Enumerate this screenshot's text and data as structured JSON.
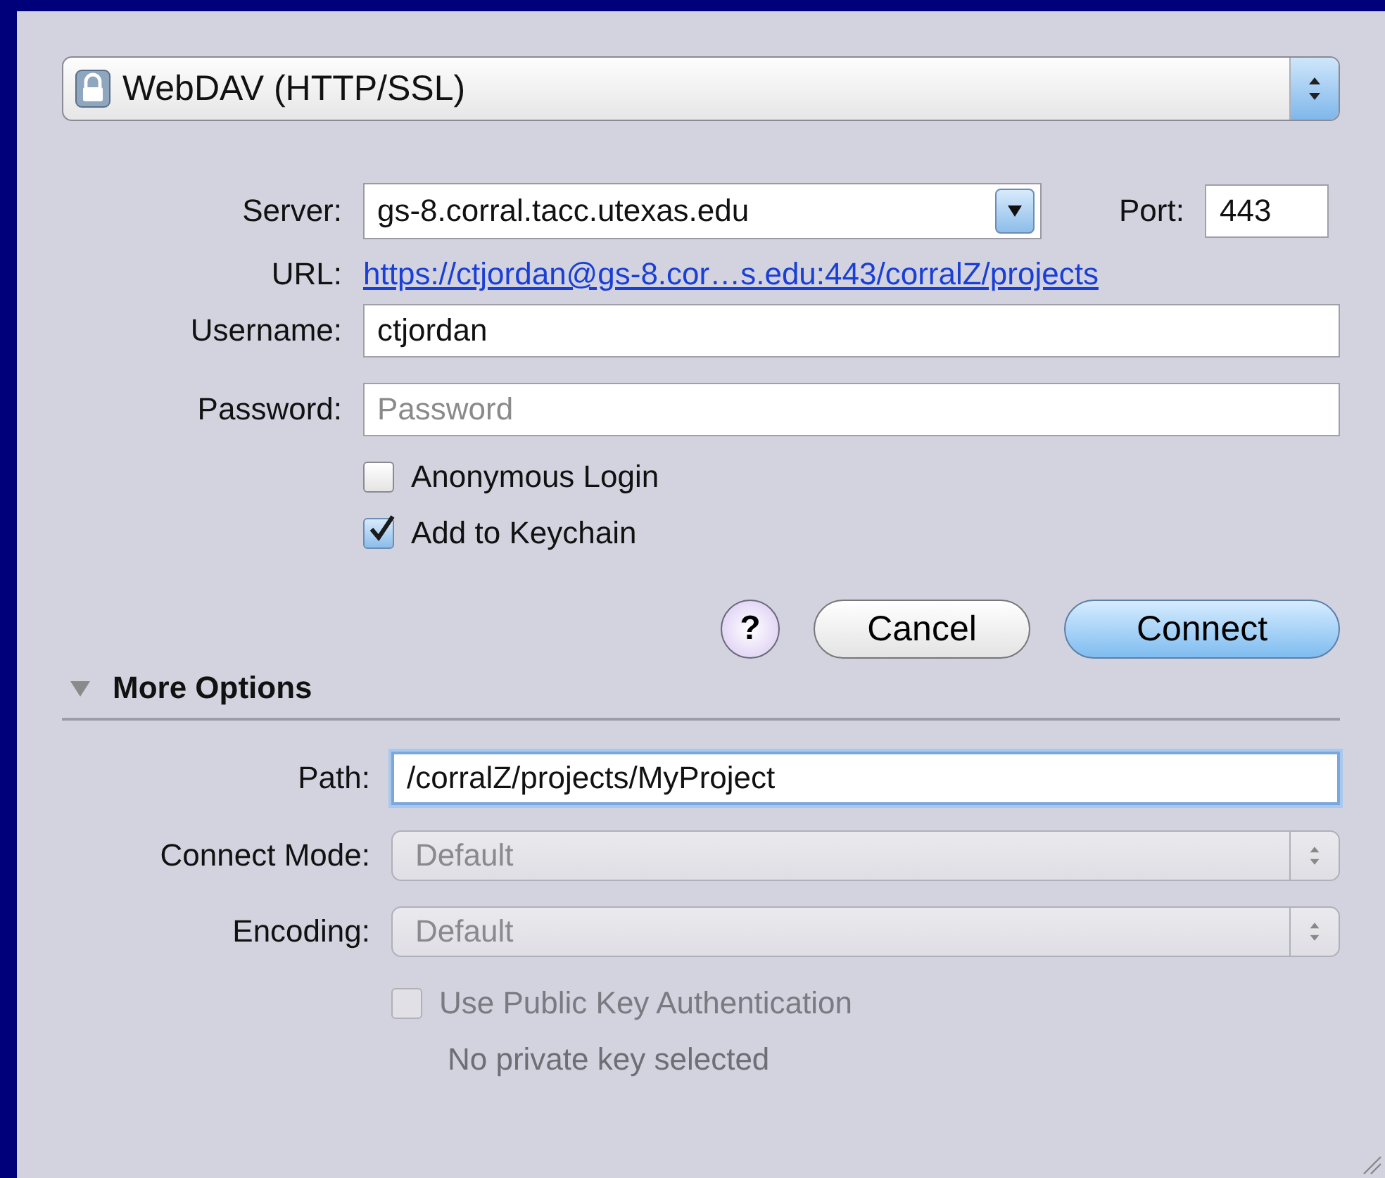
{
  "protocol": {
    "label": "WebDAV (HTTP/SSL)"
  },
  "server": {
    "label": "Server:",
    "value": "gs-8.corral.tacc.utexas.edu"
  },
  "port": {
    "label": "Port:",
    "value": "443"
  },
  "url": {
    "label": "URL:",
    "link": "https://ctjordan@gs-8.cor…s.edu:443/corralZ/projects"
  },
  "username": {
    "label": "Username:",
    "value": "ctjordan"
  },
  "password": {
    "label": "Password:",
    "placeholder": "Password"
  },
  "options": [
    {
      "label": "Anonymous Login",
      "checked": false
    },
    {
      "label": "Add to Keychain",
      "checked": true
    }
  ],
  "buttons": [
    {
      "kind": "help",
      "label": "?"
    },
    {
      "kind": "cancel",
      "label": "Cancel"
    },
    {
      "kind": "default",
      "label": "Connect"
    }
  ],
  "more_options": {
    "label": "More Options",
    "expanded": true,
    "path": {
      "label": "Path:",
      "value": "/corralZ/projects/MyProject"
    },
    "popups": [
      {
        "label": "Connect Mode:",
        "value": "Default",
        "disabled": true
      },
      {
        "label": "Encoding:",
        "value": "Default",
        "disabled": true
      }
    ],
    "public_key": {
      "label": "Use Public Key Authentication",
      "checked": false,
      "disabled": true
    },
    "key_status": "No private key selected"
  }
}
